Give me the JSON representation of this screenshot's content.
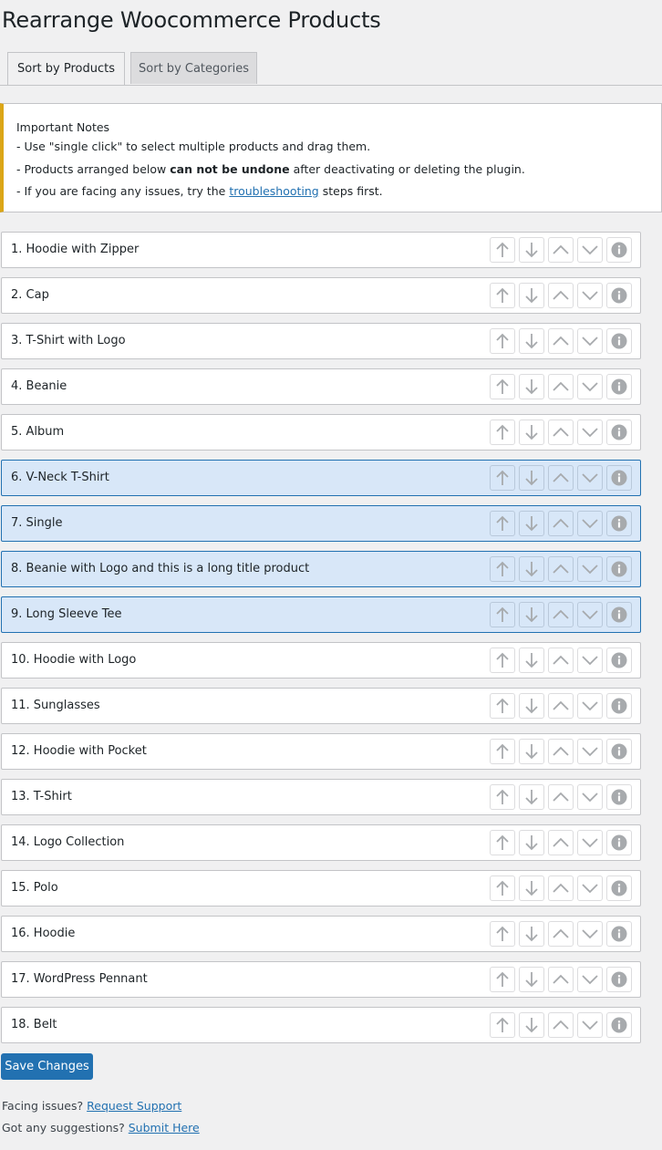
{
  "title": "Rearrange Woocommerce Products",
  "tabs": [
    "Sort by Products",
    "Sort by Categories"
  ],
  "notice": {
    "heading": "Important Notes",
    "line1": "- Use \"single click\" to select multiple products and drag them.",
    "line2_pre": "- Products arranged below ",
    "line2_bold": "can not be undone",
    "line2_post": " after deactivating or deleting the plugin.",
    "line3_pre": "- If you are facing any issues, try the ",
    "line3_link": "troubleshooting",
    "line3_post": " steps first."
  },
  "products": [
    {
      "label": "1. Hoodie with Zipper",
      "selected": false
    },
    {
      "label": "2. Cap",
      "selected": false
    },
    {
      "label": "3. T-Shirt with Logo",
      "selected": false
    },
    {
      "label": "4. Beanie",
      "selected": false
    },
    {
      "label": "5. Album",
      "selected": false
    },
    {
      "label": "6. V-Neck T-Shirt",
      "selected": true
    },
    {
      "label": "7. Single",
      "selected": true
    },
    {
      "label": "8. Beanie with Logo and this is a long title product",
      "selected": true
    },
    {
      "label": "9. Long Sleeve Tee",
      "selected": true
    },
    {
      "label": "10. Hoodie with Logo",
      "selected": false
    },
    {
      "label": "11. Sunglasses",
      "selected": false
    },
    {
      "label": "12. Hoodie with Pocket",
      "selected": false
    },
    {
      "label": "13. T-Shirt",
      "selected": false
    },
    {
      "label": "14. Logo Collection",
      "selected": false
    },
    {
      "label": "15. Polo",
      "selected": false
    },
    {
      "label": "16. Hoodie",
      "selected": false
    },
    {
      "label": "17. WordPress Pennant",
      "selected": false
    },
    {
      "label": "18. Belt",
      "selected": false
    }
  ],
  "row_controls": [
    "arrow-up-icon",
    "arrow-down-icon",
    "chevron-up-icon",
    "chevron-down-icon",
    "info-icon"
  ],
  "save_label": "Save Changes",
  "footer": {
    "issues_text": "Facing issues?",
    "issues_link": "Request Support",
    "suggest_text": "Got any suggestions?",
    "suggest_link": "Submit Here"
  },
  "colors": {
    "accent": "#2271b1",
    "selected_row": "#d8e7f8",
    "notice_border": "#dba617",
    "icon": "#a7aaad"
  }
}
